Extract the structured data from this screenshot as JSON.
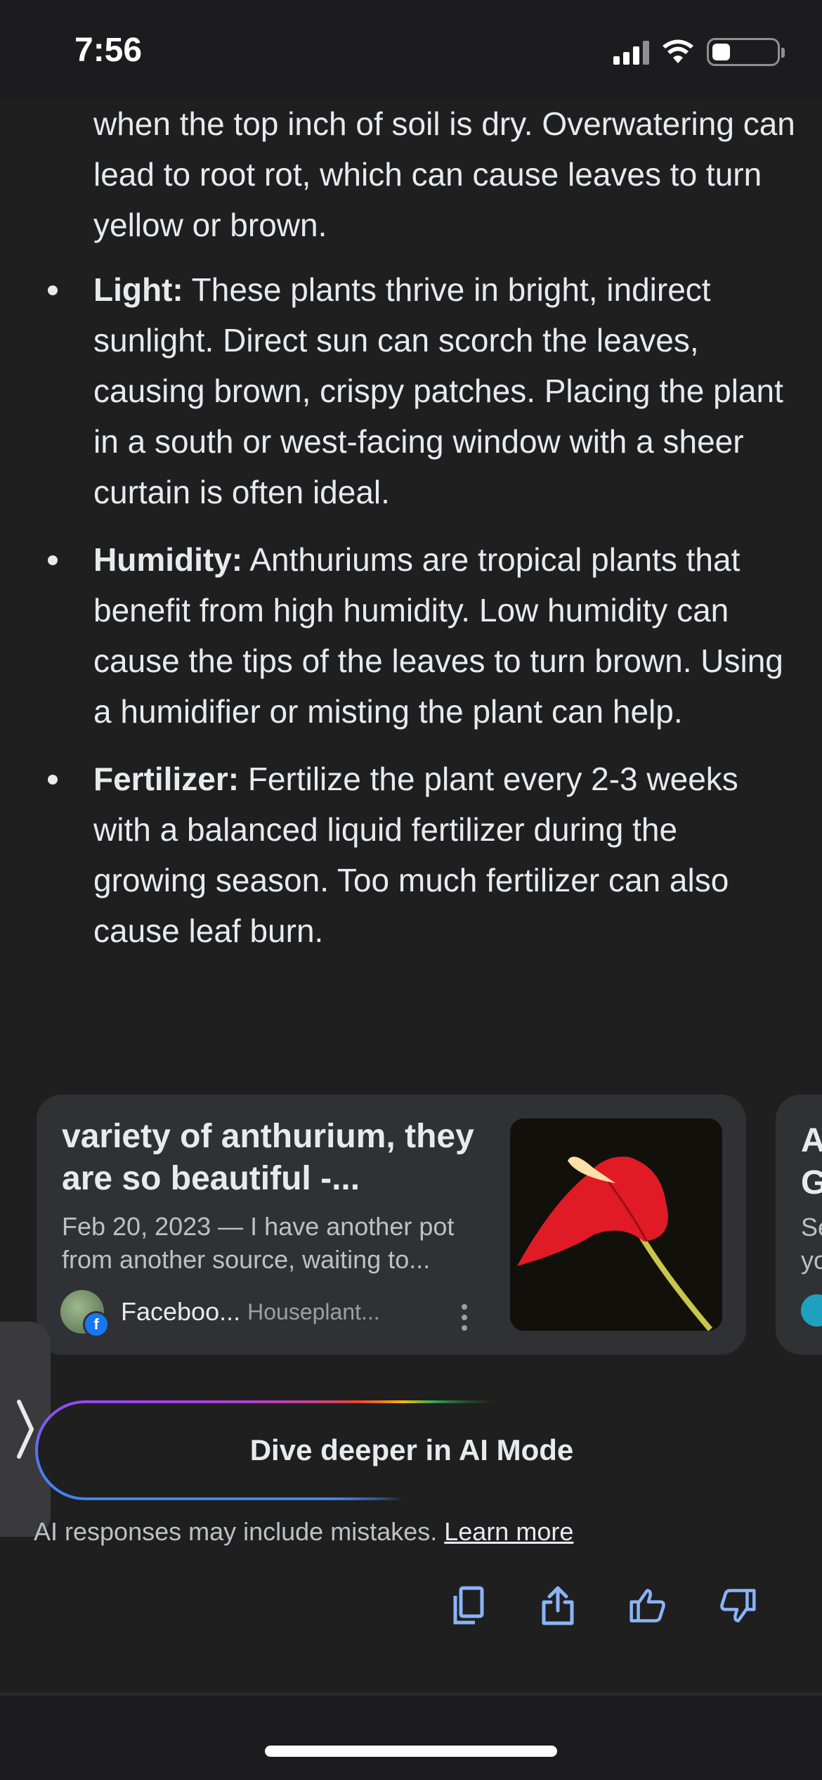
{
  "status": {
    "time": "7:56",
    "battery_level": 0.25,
    "icons": [
      "signal-icon",
      "wifi-icon",
      "battery-icon"
    ]
  },
  "answer": {
    "continuation": "when the top inch of soil is dry. Overwatering can lead to root rot, which can cause leaves to turn yellow or brown.",
    "bullets": [
      {
        "term": "Light:",
        "text": " These plants thrive in bright, indirect sunlight. Direct sun can scorch the leaves, causing brown, crispy patches. Placing the plant in a south or west-facing window with a sheer curtain is often ideal."
      },
      {
        "term": "Humidity:",
        "text": " Anthuriums are tropical plants that benefit from high humidity. Low humidity can cause the tips of the leaves to turn brown. Using a humidifier or misting the plant can help."
      },
      {
        "term": "Fertilizer:",
        "text": " Fertilize the plant every 2-3 weeks with a balanced liquid fertilizer during the growing season. Too much fertilizer can also cause leaf burn."
      }
    ]
  },
  "source_card": {
    "title": "variety of anthurium, they are so beautiful -...",
    "snippet": "Feb 20, 2023 — I have another pot from another source, waiting to...",
    "source_name": "Faceboo...",
    "source_sub": "Houseplant...",
    "fb_badge": "f",
    "image_icon": "anthurium-flower-image"
  },
  "next_card_peek": {
    "title_line1": "A",
    "title_line2": "G",
    "snippet_line1": "Se",
    "snippet_line2": "yo"
  },
  "side_handle": {
    "glyph": "❭"
  },
  "ai_mode": {
    "label": "Dive deeper in AI Mode"
  },
  "disclaimer": {
    "text": "AI responses may include mistakes. ",
    "link": "Learn more"
  },
  "actions": [
    "copy-icon",
    "share-icon",
    "thumbs-up-icon",
    "thumbs-down-icon"
  ],
  "colors": {
    "background": "#1f1f1f",
    "card": "#303134",
    "text": "#e8eaed",
    "muted": "#bdc1c6",
    "icon_blue": "#8ab4f8",
    "facebook": "#1877f2"
  }
}
